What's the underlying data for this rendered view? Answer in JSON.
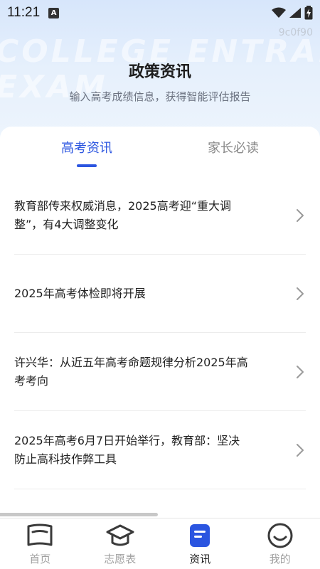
{
  "status_bar": {
    "time": "11:21",
    "app_icon_glyph": "A"
  },
  "header": {
    "watermark_line1": "COLLEGE ENTRANCE",
    "watermark_line2": "EXAM",
    "code": "9c0f90",
    "title": "政策资讯",
    "subtitle": "输入高考成绩信息，获得智能评估报告"
  },
  "tabs": [
    {
      "label": "高考资讯",
      "active": true
    },
    {
      "label": "家长必读",
      "active": false
    }
  ],
  "articles": [
    {
      "title": "教育部传来权威消息，2025高考迎“重大调整”，有4大调整变化"
    },
    {
      "title": "2025年高考体检即将开展"
    },
    {
      "title": "许兴华：从近五年高考命题规律分析2025年高考考向"
    },
    {
      "title": "2025年高考6月7日开始举行，教育部：坚决防止高科技作弊工具"
    }
  ],
  "bottom_nav": [
    {
      "label": "首页",
      "icon": "home-book-icon",
      "active": false
    },
    {
      "label": "志愿表",
      "icon": "graduation-cap-icon",
      "active": false
    },
    {
      "label": "资讯",
      "icon": "news-doc-icon",
      "active": true
    },
    {
      "label": "我的",
      "icon": "smile-face-icon",
      "active": false
    }
  ],
  "colors": {
    "accent": "#2b55e0",
    "text_primary": "#222222",
    "text_secondary": "#8a8a8a"
  }
}
